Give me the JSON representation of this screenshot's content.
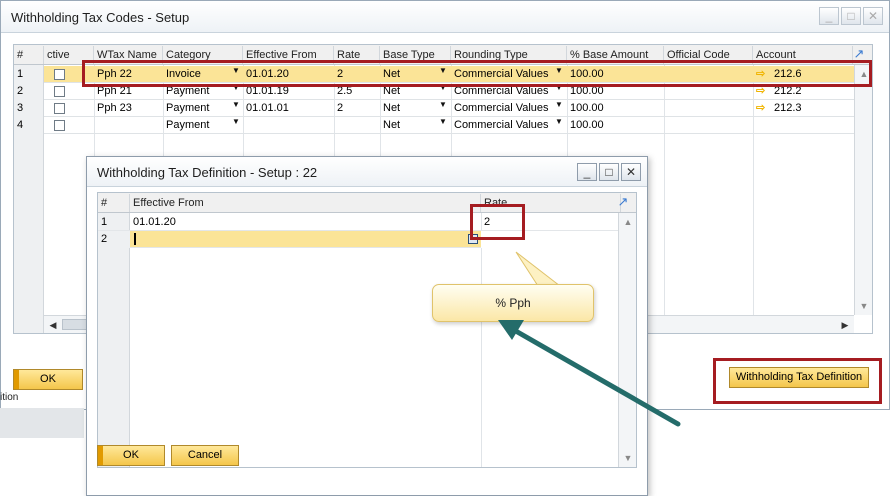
{
  "outer": {
    "title": "Withholding Tax Codes - Setup",
    "columns": [
      "#",
      "ctive",
      "WTax Name",
      "Category",
      "Effective From",
      "Rate",
      "Base Type",
      "Rounding Type",
      "% Base Amount",
      "Official Code",
      "Account"
    ],
    "rows": [
      {
        "num": "1",
        "name": "Pph 22",
        "category": "Invoice",
        "effective": "01.01.20",
        "rate": "2",
        "base": "Net",
        "rounding": "Commercial Values",
        "pct": "100.00",
        "official": "",
        "account": "212.6"
      },
      {
        "num": "2",
        "name": "Pph 21",
        "category": "Payment",
        "effective": "01.01.19",
        "rate": "2.5",
        "base": "Net",
        "rounding": "Commercial Values",
        "pct": "100.00",
        "official": "",
        "account": "212.2"
      },
      {
        "num": "3",
        "name": "Pph 23",
        "category": "Payment",
        "effective": "01.01.01",
        "rate": "2",
        "base": "Net",
        "rounding": "Commercial Values",
        "pct": "100.00",
        "official": "",
        "account": "212.3"
      },
      {
        "num": "4",
        "name": "",
        "category": "Payment",
        "effective": "",
        "rate": "",
        "base": "Net",
        "rounding": "Commercial Values",
        "pct": "100.00",
        "official": "",
        "account": ""
      }
    ],
    "ok_label": "OK",
    "def_button_label": "Withholding Tax Definition",
    "partial_label": "ition"
  },
  "dialog": {
    "title": "Withholding Tax Definition - Setup : 22",
    "columns": [
      "#",
      "Effective From",
      "Rate"
    ],
    "rows": [
      {
        "num": "1",
        "effective": "01.01.20",
        "rate": "2"
      },
      {
        "num": "2",
        "effective": "",
        "rate": ""
      }
    ],
    "ok_label": "OK",
    "cancel_label": "Cancel"
  },
  "tooltip": {
    "text": "% Pph"
  },
  "colors": {
    "highlight": "#a51c21",
    "selected_row": "#fbe497",
    "arrow": "#246c6a",
    "button": "#f4c64b"
  }
}
